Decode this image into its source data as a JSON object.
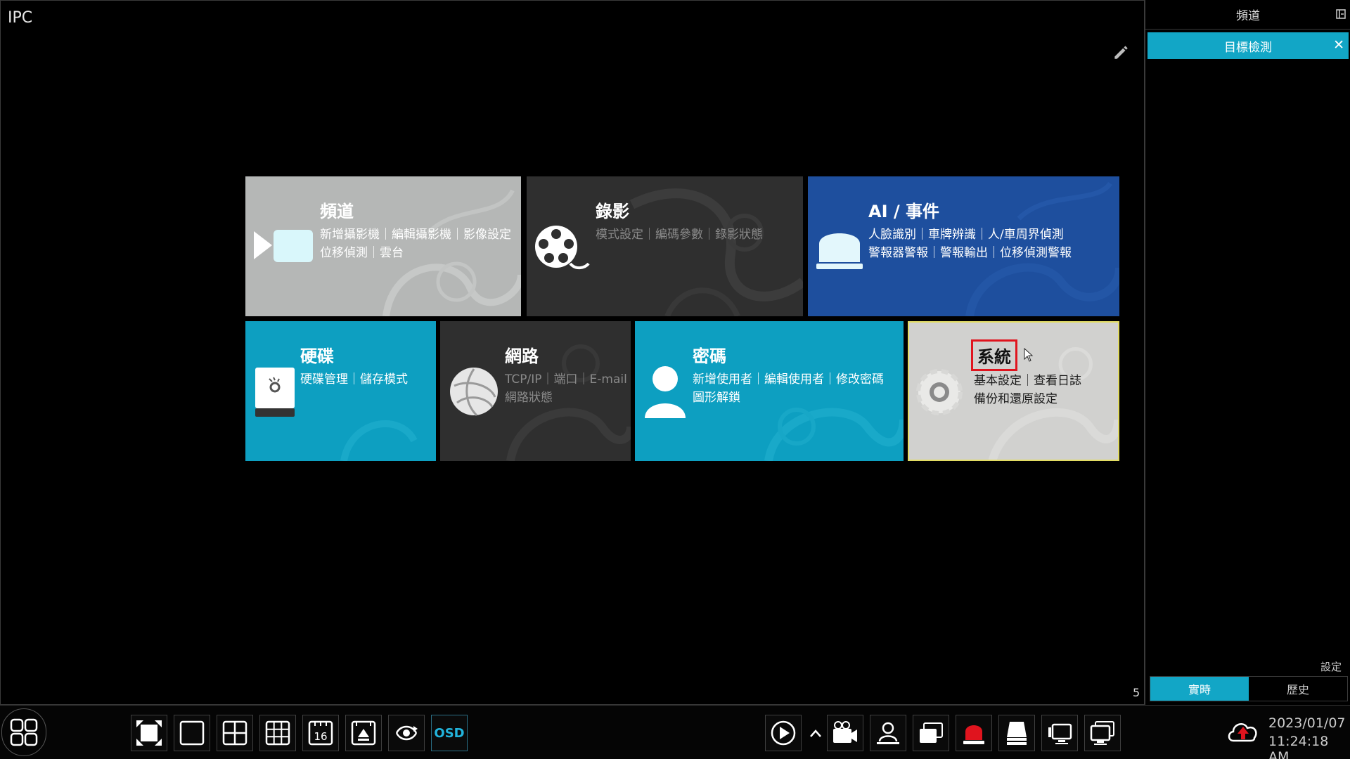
{
  "view": {
    "label": "IPC",
    "pane_number": "5"
  },
  "tiles": {
    "channel": {
      "title": "頻道",
      "line1": "新增攝影機｜編輯攝影機｜影像設定",
      "line2": "位移偵測｜雲台"
    },
    "record": {
      "title": "錄影",
      "line1": "模式設定｜編碼參數｜錄影狀態"
    },
    "ai": {
      "title": "AI / 事件",
      "line1": "人臉識別｜車牌辨識｜人/車周界偵測",
      "line2": "警報器警報｜警報輸出｜位移偵測警報"
    },
    "disk": {
      "title": "硬碟",
      "line1": "硬碟管理｜儲存模式"
    },
    "network": {
      "title": "網路",
      "line1": "TCP/IP｜端口｜E-mail",
      "line2": "網路狀態"
    },
    "password": {
      "title": "密碼",
      "line1": "新增使用者｜編輯使用者｜修改密碼",
      "line2": "圖形解鎖"
    },
    "system": {
      "title": "系統",
      "line1": "基本設定｜查看日誌",
      "line2": "備份和還原設定"
    }
  },
  "sidebar": {
    "header": "頻道",
    "selected_item": "目標檢測",
    "settings_label": "設定",
    "tabs": [
      {
        "label": "實時",
        "active": true
      },
      {
        "label": "歷史",
        "active": false
      }
    ]
  },
  "taskbar": {
    "osd_label": "OSD",
    "layout_16_label": "16",
    "date": "2023/01/07",
    "time": "11:24:18 AM"
  },
  "colors": {
    "accent_cyan": "#12a6c6",
    "tile_blue": "#1e4f9e",
    "tile_grey": "#b5b7b6",
    "tile_dark": "#2f2f2f",
    "highlight_red": "#e0141e"
  }
}
